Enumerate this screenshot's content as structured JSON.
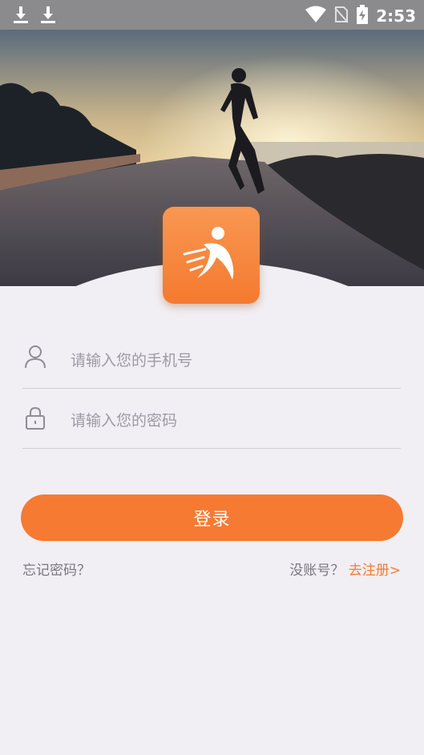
{
  "status_bar": {
    "time": "2:53",
    "icons": [
      "download-icon",
      "download-icon",
      "wifi-icon",
      "no-sim-icon",
      "battery-charging-icon"
    ]
  },
  "app": {
    "logo_icon": "runner-icon",
    "accent": "#f67a32"
  },
  "form": {
    "phone_placeholder": "请输入您的手机号",
    "phone_icon": "user-icon",
    "password_placeholder": "请输入您的密码",
    "password_icon": "lock-icon",
    "login_label": "登录",
    "forgot_label": "忘记密码？",
    "no_account_label": "没账号？",
    "register_label": "去注册>"
  }
}
